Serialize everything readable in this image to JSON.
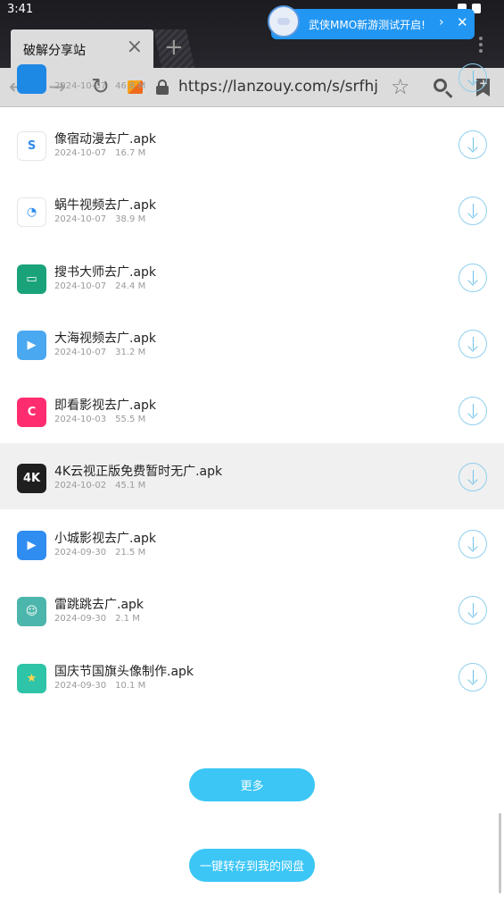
{
  "status_bar": {
    "time": "3:41"
  },
  "browser": {
    "tab_title": "破解分享站",
    "url": "https://lanzouy.com/s/srfhj"
  },
  "notification": {
    "text": "武侠MMO新游测试开启!"
  },
  "files": [
    {
      "name": "",
      "date": "2024-10-07",
      "size": "46.8 M",
      "icon": "app-icon-partial",
      "color": "#1e88e5"
    },
    {
      "name": "像宿动漫去广.apk",
      "date": "2024-10-07",
      "size": "16.7 M",
      "icon": "xiangsu-icon",
      "color": "#ffffff"
    },
    {
      "name": "蜗牛视频去广.apk",
      "date": "2024-10-07",
      "size": "38.9 M",
      "icon": "snail-icon",
      "color": "#ffffff"
    },
    {
      "name": "搜书大师去广.apk",
      "date": "2024-10-07",
      "size": "24.4 M",
      "icon": "book-icon",
      "color": "#1aa37a"
    },
    {
      "name": "大海视频去广.apk",
      "date": "2024-10-07",
      "size": "31.2 M",
      "icon": "tv-icon",
      "color": "#4aa8f0"
    },
    {
      "name": "即看影视去广.apk",
      "date": "2024-10-03",
      "size": "55.5 M",
      "icon": "play-c-icon",
      "color": "#ff2d6f"
    },
    {
      "name": "4K云视正版免费暂时无广.apk",
      "date": "2024-10-02",
      "size": "45.1 M",
      "icon": "4k-icon",
      "color": "#1f1f1f"
    },
    {
      "name": "小城影视去广.apk",
      "date": "2024-09-30",
      "size": "21.5 M",
      "icon": "play-icon",
      "color": "#2f8cf0"
    },
    {
      "name": "雷跳跳去广.apk",
      "date": "2024-09-30",
      "size": "2.1 M",
      "icon": "face-icon",
      "color": "#4db6ac"
    },
    {
      "name": "国庆节国旗头像制作.apk",
      "date": "2024-09-30",
      "size": "10.1 M",
      "icon": "flag-icon",
      "color": "#2ec4a8"
    }
  ],
  "buttons": {
    "more": "更多",
    "save_to_drive": "一键转存到我的网盘"
  }
}
